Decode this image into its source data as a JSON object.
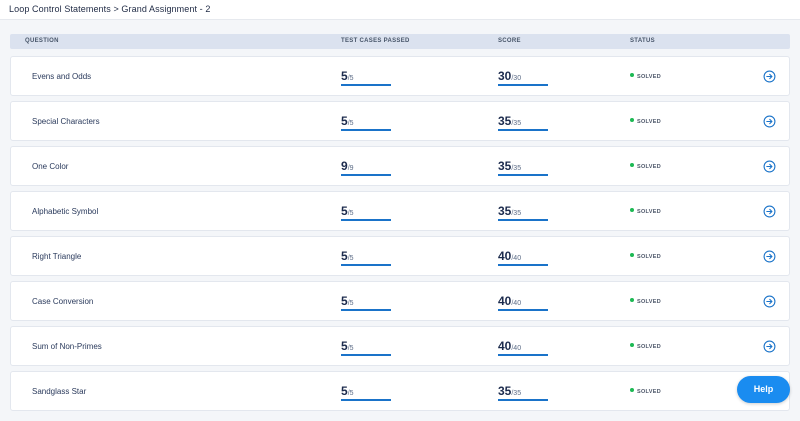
{
  "breadcrumb": {
    "parent": "Loop Control Statements",
    "separator": " > ",
    "current": "Grand Assignment - 2"
  },
  "table": {
    "headers": {
      "question": "QUESTION",
      "tests": "TEST CASES PASSED",
      "score": "SCORE",
      "status": "STATUS"
    },
    "rows": [
      {
        "question": "Evens and Odds",
        "tests_passed": "5",
        "tests_total": "/5",
        "score": "30",
        "score_total": "/30",
        "status": "SOLVED"
      },
      {
        "question": "Special Characters",
        "tests_passed": "5",
        "tests_total": "/5",
        "score": "35",
        "score_total": "/35",
        "status": "SOLVED"
      },
      {
        "question": "One Color",
        "tests_passed": "9",
        "tests_total": "/9",
        "score": "35",
        "score_total": "/35",
        "status": "SOLVED"
      },
      {
        "question": "Alphabetic Symbol",
        "tests_passed": "5",
        "tests_total": "/5",
        "score": "35",
        "score_total": "/35",
        "status": "SOLVED"
      },
      {
        "question": "Right Triangle",
        "tests_passed": "5",
        "tests_total": "/5",
        "score": "40",
        "score_total": "/40",
        "status": "SOLVED"
      },
      {
        "question": "Case Conversion",
        "tests_passed": "5",
        "tests_total": "/5",
        "score": "40",
        "score_total": "/40",
        "status": "SOLVED"
      },
      {
        "question": "Sum of Non-Primes",
        "tests_passed": "5",
        "tests_total": "/5",
        "score": "40",
        "score_total": "/40",
        "status": "SOLVED"
      },
      {
        "question": "Sandglass Star",
        "tests_passed": "5",
        "tests_total": "/5",
        "score": "35",
        "score_total": "/35",
        "status": "SOLVED"
      }
    ]
  },
  "colors": {
    "accent": "#1a73c9",
    "solved": "#1db954",
    "help": "#1a8cf0"
  },
  "icons": {
    "row_action": "arrow-right-circle-icon",
    "status": "status-dot-icon"
  },
  "help": {
    "label": "Help"
  }
}
